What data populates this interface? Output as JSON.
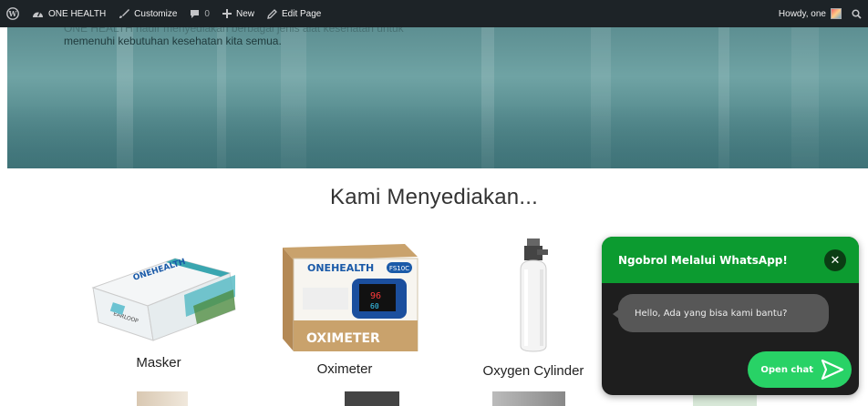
{
  "adminbar": {
    "site_name": "ONE HEALTH",
    "customize": "Customize",
    "comments_count": "0",
    "new": "New",
    "edit_page": "Edit Page",
    "howdy": "Howdy, one"
  },
  "hero": {
    "line1": "ONE HEALTH hadir menyediakan berbagai jenis alat kesehatan untuk",
    "line2": "memenuhi kebutuhan kesehatan kita semua."
  },
  "section": {
    "title": "Kami Menyediakan..."
  },
  "products": [
    {
      "label": "Masker",
      "box_brand": "ONEHEALTH",
      "box_text": "EARLOOP"
    },
    {
      "label": "Oximeter",
      "box_brand": "ONEHEALTH",
      "box_model": "FS10C",
      "box_text": "OXIMETER"
    },
    {
      "label": "Oxygen Cylinder"
    }
  ],
  "chat": {
    "header": "Ngobrol Melalui WhatsApp!",
    "message": "Hello, Ada yang bisa kami bantu?",
    "open_button": "Open chat"
  },
  "colors": {
    "adminbar_bg": "#1d2327",
    "chat_header": "#0c9b30",
    "chat_button": "#28d266"
  }
}
